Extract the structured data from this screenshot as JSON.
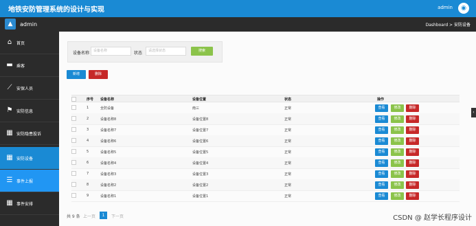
{
  "header": {
    "title": "地铁安防管理系统的设计与实现",
    "user": "admin"
  },
  "subbar": {
    "user": "admin",
    "breadcrumb": "Dashboard > 安防设备"
  },
  "sidebar": {
    "items": [
      {
        "label": "首页",
        "icon": "home-icon"
      },
      {
        "label": "乘客",
        "icon": "briefcase-icon"
      },
      {
        "label": "安保人员",
        "icon": "chart-icon"
      },
      {
        "label": "安防信息",
        "icon": "flag-icon"
      },
      {
        "label": "安防隐患投诉",
        "icon": "grid-icon"
      },
      {
        "label": "安防设备",
        "icon": "grid-icon"
      },
      {
        "label": "事件上报",
        "icon": "sliders-icon"
      },
      {
        "label": "事件安排",
        "icon": "grid-icon"
      }
    ]
  },
  "search": {
    "name_label": "设备名称",
    "name_placeholder": "设备名称",
    "status_label": "状态",
    "status_placeholder": "请选择状态",
    "search_button": "搜索"
  },
  "toolbar": {
    "add": "新增",
    "delete": "删除"
  },
  "table": {
    "headers": [
      "序号",
      "设备名称",
      "设备位置",
      "状态",
      "操作"
    ],
    "rows": [
      [
        "1",
        "全防设备",
        "南三",
        "正常"
      ],
      [
        "2",
        "设备名称8",
        "设备位置8",
        "正常"
      ],
      [
        "3",
        "设备名称7",
        "设备位置7",
        "正常"
      ],
      [
        "4",
        "设备名称6",
        "设备位置6",
        "正常"
      ],
      [
        "5",
        "设备名称5",
        "设备位置5",
        "正常"
      ],
      [
        "6",
        "设备名称4",
        "设备位置4",
        "正常"
      ],
      [
        "7",
        "设备名称3",
        "设备位置3",
        "正常"
      ],
      [
        "8",
        "设备名称2",
        "设备位置2",
        "正常"
      ],
      [
        "9",
        "设备名称1",
        "设备位置1",
        "正常"
      ]
    ],
    "ops": {
      "view": "查看",
      "edit": "修改",
      "del": "删除"
    }
  },
  "pager": {
    "total": "共 9 条",
    "prev": "上一页",
    "current": "1",
    "next": "下一页"
  },
  "watermark": "CSDN @ 赵学长程序设计"
}
